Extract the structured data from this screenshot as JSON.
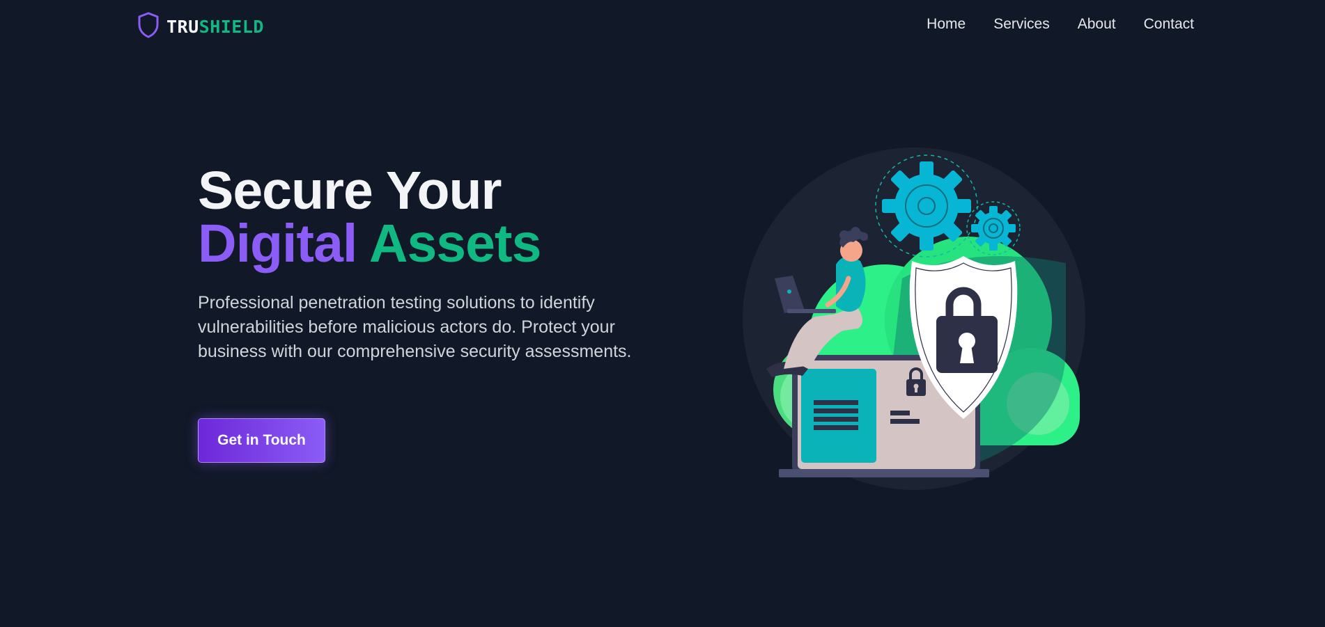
{
  "brand": {
    "name_part1": "TRU",
    "name_part2": "SHIELD",
    "colors": {
      "primary": "#8b5cf6",
      "accent": "#10b981",
      "background": "#111827"
    },
    "icon": "shield-icon"
  },
  "nav": {
    "items": [
      {
        "label": "Home"
      },
      {
        "label": "Services"
      },
      {
        "label": "About"
      },
      {
        "label": "Contact"
      }
    ]
  },
  "hero": {
    "title_line1": "Secure Your",
    "title_word_purple": "Digital",
    "title_word_green": "Assets",
    "description": "Professional penetration testing solutions to identify vulnerabilities before malicious actors do. Protect your business with our comprehensive security assessments.",
    "cta_label": "Get in Touch"
  },
  "illustration": {
    "icons": [
      "gear-icon",
      "padlock-icon",
      "shield-icon",
      "laptop-icon",
      "person-icon"
    ]
  }
}
